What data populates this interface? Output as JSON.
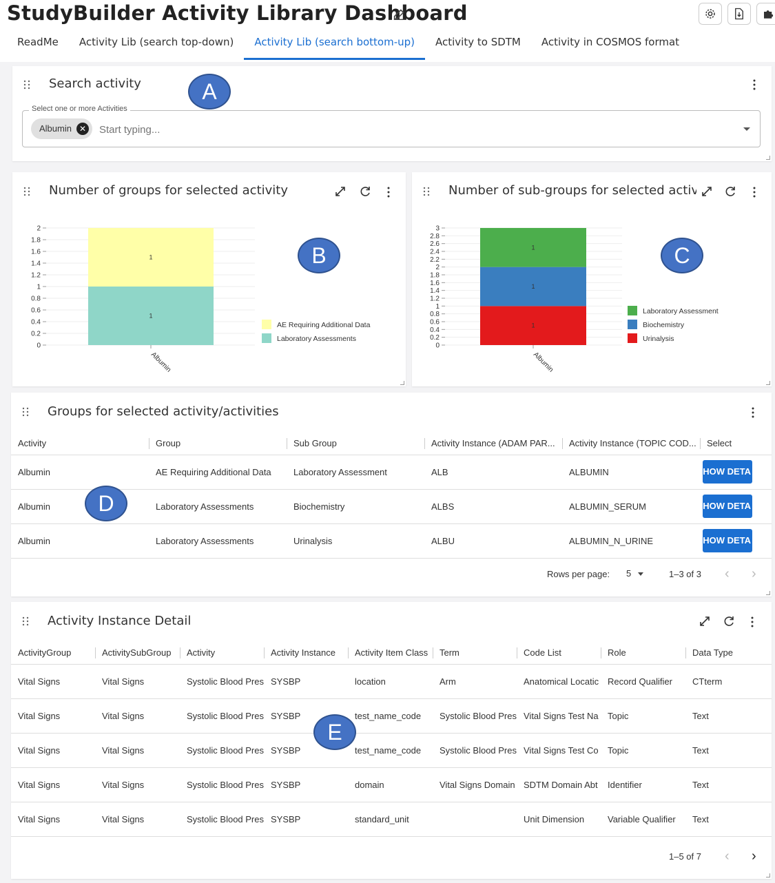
{
  "app": {
    "title": "StudyBuilder Activity Library Dashboard"
  },
  "tabs": [
    {
      "label": "ReadMe"
    },
    {
      "label": "Activity Lib (search top-down)"
    },
    {
      "label": "Activity Lib (search bottom-up)",
      "active": true
    },
    {
      "label": "Activity to SDTM"
    },
    {
      "label": "Activity in COSMOS format"
    }
  ],
  "search": {
    "title": "Search activity",
    "field_label": "Select one or more Activities",
    "chip": "Albumin",
    "placeholder": "Start typing..."
  },
  "groups_chart": {
    "title": "Number of groups for selected activity",
    "chart_data": {
      "type": "bar",
      "stacked": true,
      "categories": [
        "Albumin"
      ],
      "series": [
        {
          "name": "Laboratory Assessments",
          "values": [
            1
          ],
          "color": "#8fd6c8"
        },
        {
          "name": "AE Requiring Additional Data",
          "values": [
            1
          ],
          "color": "#ffffa8"
        }
      ],
      "ylim": [
        0,
        2
      ],
      "yticks": [
        "0",
        "0.2",
        "0.4",
        "0.6",
        "0.8",
        "1",
        "1.2",
        "1.4",
        "1.6",
        "1.8",
        "2"
      ],
      "data_labels": [
        "1",
        "1"
      ],
      "legend": [
        "AE Requiring Additional Data",
        "Laboratory Assessments"
      ],
      "legend_position": "right"
    }
  },
  "subgroups_chart": {
    "title": "Number of sub-groups for selected activit",
    "chart_data": {
      "type": "bar",
      "stacked": true,
      "categories": [
        "Albumin"
      ],
      "series": [
        {
          "name": "Urinalysis",
          "values": [
            1
          ],
          "color": "#e31a1c"
        },
        {
          "name": "Biochemistry",
          "values": [
            1
          ],
          "color": "#3a7ebf"
        },
        {
          "name": "Laboratory Assessment",
          "values": [
            1
          ],
          "color": "#4cae4c"
        }
      ],
      "ylim": [
        0,
        3
      ],
      "yticks": [
        "0",
        "0.2",
        "0.4",
        "0.6",
        "0.8",
        "1",
        "1.2",
        "1.4",
        "1.6",
        "1.8",
        "2",
        "2.2",
        "2.4",
        "2.6",
        "2.8",
        "3"
      ],
      "data_labels": [
        "1",
        "1",
        "1"
      ],
      "legend": [
        "Laboratory Assessment",
        "Biochemistry",
        "Urinalysis"
      ],
      "legend_position": "right"
    }
  },
  "groups_table": {
    "title": "Groups for selected activity/activities",
    "columns": [
      "Activity",
      "Group",
      "Sub Group",
      "Activity Instance (ADAM PAR...",
      "Activity Instance (TOPIC COD...",
      "Select"
    ],
    "rows": [
      [
        "Albumin",
        "AE Requiring Additional Data",
        "Laboratory Assessment",
        "ALB",
        "ALBUMIN",
        "HOW DETA"
      ],
      [
        "Albumin",
        "Laboratory Assessments",
        "Biochemistry",
        "ALBS",
        "ALBUMIN_SERUM",
        "HOW DETA"
      ],
      [
        "Albumin",
        "Laboratory Assessments",
        "Urinalysis",
        "ALBU",
        "ALBUMIN_N_URINE",
        "HOW DETA"
      ]
    ],
    "rows_per_page_label": "Rows per page:",
    "rows_per_page": "5",
    "range": "1–3 of 3"
  },
  "detail_table": {
    "title": "Activity Instance Detail",
    "columns": [
      "ActivityGroup",
      "ActivitySubGroup",
      "Activity",
      "Activity Instance",
      "Activity Item Class",
      "Term",
      "Code List",
      "Role",
      "Data Type"
    ],
    "rows": [
      [
        "Vital Signs",
        "Vital Signs",
        "Systolic Blood Pres",
        "SYSBP",
        "location",
        "Arm",
        "Anatomical Locatic",
        "Record Qualifier",
        "CTterm"
      ],
      [
        "Vital Signs",
        "Vital Signs",
        "Systolic Blood Pres",
        "SYSBP",
        "test_name_code",
        "Systolic Blood Pres",
        "Vital Signs Test Na",
        "Topic",
        "Text"
      ],
      [
        "Vital Signs",
        "Vital Signs",
        "Systolic Blood Pres",
        "SYSBP",
        "test_name_code",
        "Systolic Blood Pres",
        "Vital Signs Test Co",
        "Topic",
        "Text"
      ],
      [
        "Vital Signs",
        "Vital Signs",
        "Systolic Blood Pres",
        "SYSBP",
        "domain",
        "Vital Signs Domain",
        "SDTM Domain Abt",
        "Identifier",
        "Text"
      ],
      [
        "Vital Signs",
        "Vital Signs",
        "Systolic Blood Pres",
        "SYSBP",
        "standard_unit",
        "",
        "Unit Dimension",
        "Variable Qualifier",
        "Text"
      ]
    ],
    "range": "1–5 of 7"
  },
  "callouts": [
    "A",
    "B",
    "C",
    "D",
    "E"
  ],
  "icons": [
    "edit-icon",
    "gear-icon",
    "download-icon",
    "puzzle-icon",
    "grip-icon",
    "kebab-icon",
    "expand-icon",
    "refresh-icon",
    "chevron-left-icon",
    "chevron-right-icon",
    "caret-down-icon",
    "close-icon"
  ]
}
